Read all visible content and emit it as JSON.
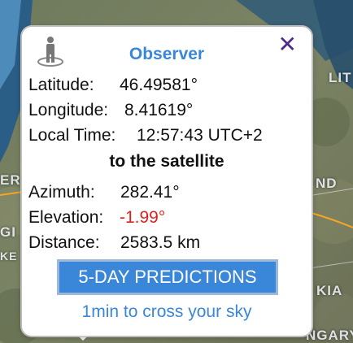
{
  "map": {
    "labels": [
      "LIT",
      "ND",
      "KIA",
      "ER",
      "GI",
      "KE",
      "NGARY"
    ]
  },
  "popup": {
    "title": "Observer",
    "close_symbol": "✕",
    "icon": "observer-person-icon",
    "latitude_label": "Latitude:",
    "latitude_value": "46.49581°",
    "longitude_label": "Longitude:",
    "longitude_value": "8.41619°",
    "localtime_label": "Local Time:",
    "localtime_value": "12:57:43 UTC+2",
    "section_title": "to the satellite",
    "azimuth_label": "Azimuth:",
    "azimuth_value": "282.41°",
    "elevation_label": "Elevation:",
    "elevation_value": "-1.99°",
    "distance_label": "Distance:",
    "distance_value": "2583.5 km",
    "predictions_button": "5-DAY PREDICTIONS",
    "cross_link": "1min to cross your sky"
  },
  "colors": {
    "accent": "#3a86d8",
    "negative": "#e02020",
    "close": "#4b2a8c",
    "orbit_line": "#f5a623"
  }
}
